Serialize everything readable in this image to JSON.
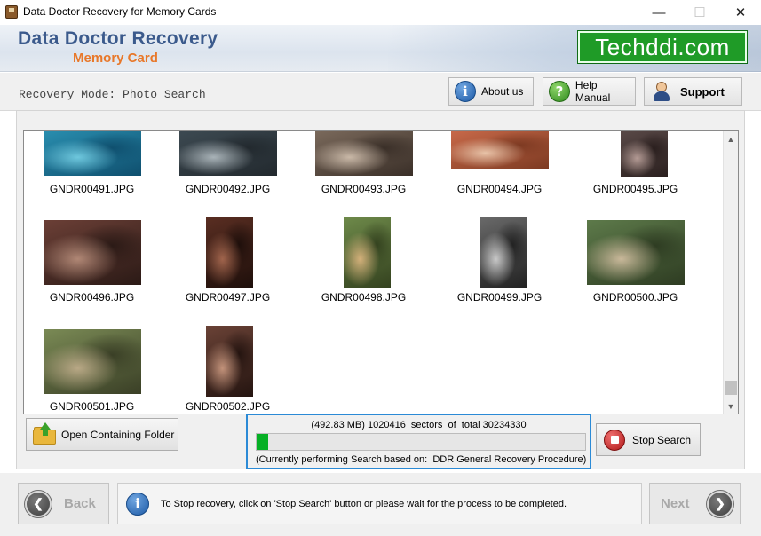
{
  "window": {
    "title": "Data Doctor Recovery for Memory Cards",
    "minimize_glyph": "—",
    "maximize_glyph": "☐",
    "close_glyph": "✕"
  },
  "header": {
    "brand_line1": "Data Doctor Recovery",
    "brand_line2": "Memory Card",
    "logo_text": "Techddi.com",
    "brand_color": "#3b5a8c",
    "accent_color": "#e8782a",
    "logo_color": "#1f9b27"
  },
  "toolbar": {
    "mode_label": "Recovery Mode: Photo Search",
    "about_label": "About us",
    "help_label": "Help Manual",
    "support_label": "Support",
    "about_icon": "info-icon",
    "help_icon": "question-icon",
    "support_icon": "person-icon"
  },
  "gallery": {
    "files": [
      {
        "name": "GNDR00491.JPG",
        "tones": [
          "#2a8fb0",
          "#6ec7dd",
          "#0f4f6e"
        ]
      },
      {
        "name": "GNDR00492.JPG",
        "tones": [
          "#3d4a52",
          "#a9b3b8",
          "#22292e"
        ]
      },
      {
        "name": "GNDR00493.JPG",
        "tones": [
          "#7b6a5c",
          "#c9b8a7",
          "#3a2f28"
        ]
      },
      {
        "name": "GNDR00494.JPG",
        "tones": [
          "#c96a4a",
          "#e8c3a8",
          "#7d3a22"
        ]
      },
      {
        "name": "GNDR00495.JPG",
        "tones": [
          "#5a4a48",
          "#b39a94",
          "#2a1f1e"
        ]
      },
      {
        "name": "GNDR00496.JPG",
        "tones": [
          "#6b3f36",
          "#b08775",
          "#2b1a16"
        ]
      },
      {
        "name": "GNDR00497.JPG",
        "tones": [
          "#5a2e22",
          "#a0644c",
          "#1e0f0b"
        ]
      },
      {
        "name": "GNDR00498.JPG",
        "tones": [
          "#6e8a4a",
          "#d3b07a",
          "#34421f"
        ]
      },
      {
        "name": "GNDR00499.JPG",
        "tones": [
          "#6a6a6a",
          "#c8c8c8",
          "#222222"
        ]
      },
      {
        "name": "GNDR00500.JPG",
        "tones": [
          "#5d7a4a",
          "#c9b89a",
          "#2e3c22"
        ]
      },
      {
        "name": "GNDR00501.JPG",
        "tones": [
          "#7a8a55",
          "#b9a886",
          "#3a3f26"
        ]
      },
      {
        "name": "GNDR00502.JPG",
        "tones": [
          "#6a4236",
          "#c2927a",
          "#241410"
        ]
      }
    ]
  },
  "actions": {
    "open_folder_label": "Open Containing Folder",
    "stop_label": "Stop Search"
  },
  "progress": {
    "summary": "(492.83 MB) 1020416  sectors  of  total 30234330",
    "status": "(Currently performing Search based on:  DDR General Recovery Procedure)",
    "fraction": 0.0338,
    "fill_color": "#06b025"
  },
  "footer": {
    "back_label": "Back",
    "next_label": "Next",
    "hint_text": "To Stop recovery, click on 'Stop Search' button or please wait for the process to be completed."
  }
}
